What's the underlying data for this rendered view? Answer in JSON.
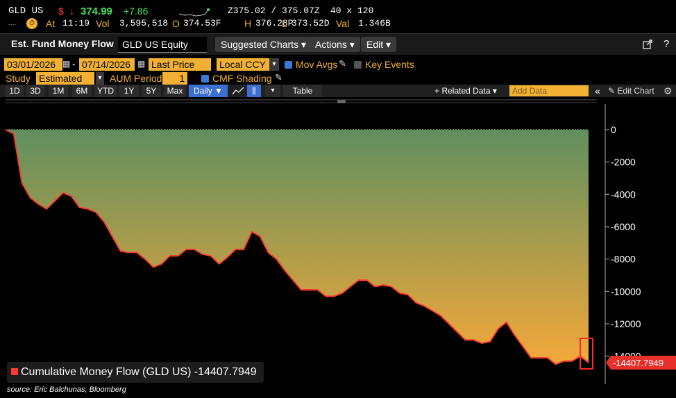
{
  "quote": {
    "ticker": "GLD US",
    "currency_symbol": "$",
    "down_arrow": "↓",
    "last": "374.99",
    "change": "+7.86",
    "bid_ask": "Z375.02 / 375.07Z",
    "size": "40 x 120",
    "at_label": "At",
    "time": "11:19",
    "vol_label": "Vol",
    "volume": "3,595,518",
    "open_label": "O",
    "open": "374.53F",
    "high_label": "H",
    "high": "376.28P",
    "low_label": "L",
    "low": "373.52D",
    "val_label": "Val",
    "value": "1.346B"
  },
  "toolbar": {
    "function_title": "Est. Fund Money Flow",
    "security": "GLD US Equity",
    "suggested_charts": "Suggested Charts",
    "actions": "Actions",
    "edit": "Edit",
    "caret": "▾"
  },
  "params": {
    "start_date": "03/01/2026",
    "end_date": "07/14/2026",
    "dash": "-",
    "price_field": "Last Price",
    "currency": "Local CCY",
    "mov_avgs": "Mov Avgs",
    "key_events": "Key Events",
    "study_label": "Study",
    "study_value": "Estimated Fu",
    "aum_label": "AUM Period",
    "aum_value": "1",
    "cmf_shading": "CMF Shading"
  },
  "period_bar": {
    "periods": [
      "1D",
      "3D",
      "1M",
      "6M",
      "YTD",
      "1Y",
      "5Y",
      "Max"
    ],
    "frequency": "Daily ▼",
    "table": "Table",
    "related_data": "+ Related Data ▾",
    "add_data_placeholder": "Add Data",
    "collapse": "«",
    "edit_chart": "Edit Chart"
  },
  "colors": {
    "series_line": "#ff3b2f",
    "fill_top": "#5f8f5f",
    "fill_bottom": "#f5a83a",
    "accent": "#f2b134",
    "highlight_box": "#ff2b2b"
  },
  "chart_data": {
    "type": "area",
    "title": "",
    "xlabel": "",
    "ylabel": "",
    "ylim": [
      -15000,
      0
    ],
    "y_ticks": [
      "0",
      "-2000",
      "-4000",
      "-6000",
      "-8000",
      "-10000",
      "-12000",
      "-14000"
    ],
    "series": [
      {
        "name": "Cumulative Money Flow (GLD US)",
        "last_value_label": "-14407.7949",
        "values": [
          0,
          -250,
          -3300,
          -4200,
          -4600,
          -4900,
          -4400,
          -3900,
          -4100,
          -4800,
          -4900,
          -5100,
          -5700,
          -6600,
          -7500,
          -7600,
          -7600,
          -8000,
          -8500,
          -8300,
          -7800,
          -7800,
          -7400,
          -7400,
          -7700,
          -7800,
          -8300,
          -7900,
          -7400,
          -7400,
          -6300,
          -6600,
          -7600,
          -8000,
          -8700,
          -9300,
          -9900,
          -9900,
          -9900,
          -10300,
          -10300,
          -10100,
          -9700,
          -9300,
          -9300,
          -9700,
          -9600,
          -9700,
          -10100,
          -10200,
          -10700,
          -10900,
          -11200,
          -11500,
          -12000,
          -12500,
          -13000,
          -13000,
          -13200,
          -13100,
          -12300,
          -11900,
          -12700,
          -13400,
          -14100,
          -14100,
          -14100,
          -14500,
          -14300,
          -14300,
          -14000,
          -14400
        ]
      }
    ]
  },
  "legend": {
    "text": "Cumulative Money Flow (GLD US) -14407.7949"
  },
  "source": "source: Eric Balchunas, Bloomberg"
}
